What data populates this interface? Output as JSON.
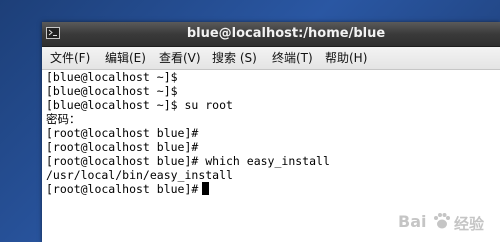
{
  "window": {
    "title": "blue@localhost:/home/blue",
    "icon": "terminal-icon"
  },
  "menu": {
    "items": [
      {
        "label": "文件(F)"
      },
      {
        "label": "编辑(E)"
      },
      {
        "label": "查看(V)"
      },
      {
        "label": "搜索 (S)"
      },
      {
        "label": "终端(T)"
      },
      {
        "label": "帮助(H)"
      }
    ]
  },
  "terminal": {
    "lines": [
      "[blue@localhost ~]$",
      "[blue@localhost ~]$",
      "[blue@localhost ~]$ su root",
      "密码：",
      "[root@localhost blue]#",
      "[root@localhost blue]#",
      "[root@localhost blue]# which easy_install",
      "/usr/local/bin/easy_install",
      "[root@localhost blue]#"
    ]
  },
  "watermark": {
    "brand": "Bai",
    "suffix": "经验",
    "logo": "baidu-paw-logo"
  },
  "colors": {
    "desktop": "#2a57a3",
    "titlebar": "#3a3a3a",
    "terminal_bg": "#ffffff",
    "terminal_fg": "#000000"
  }
}
